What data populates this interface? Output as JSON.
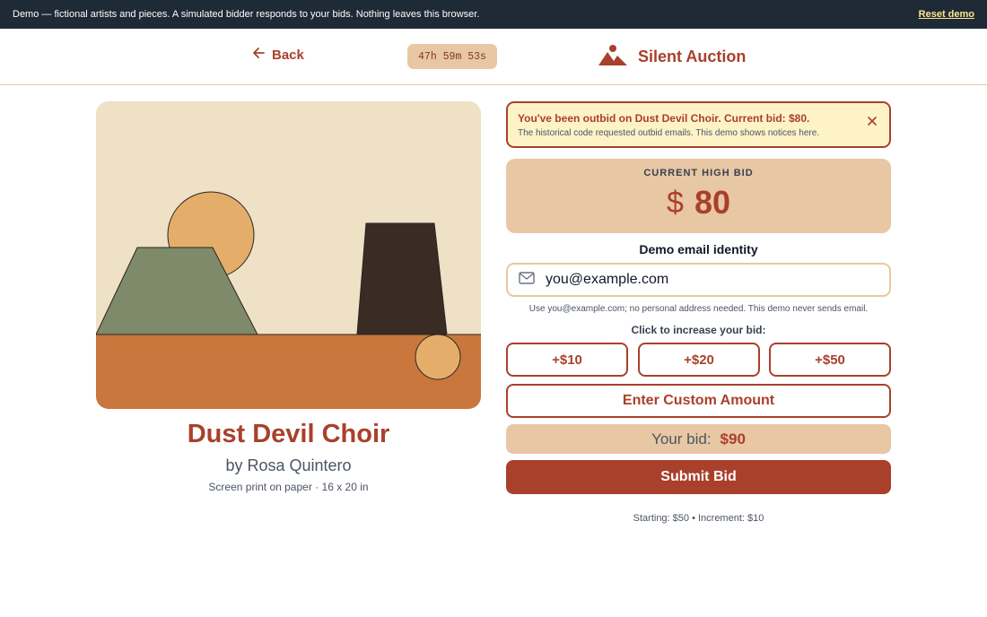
{
  "banner": {
    "message": "Demo — fictional artists and pieces. A simulated bidder responds to your bids. Nothing leaves this browser.",
    "reset_label": "Reset demo"
  },
  "header": {
    "back_label": "Back",
    "timer": "47h 59m 53s",
    "brand_title": "Silent Auction"
  },
  "artwork": {
    "title": "Dust Devil Choir",
    "artist": "by Rosa Quintero",
    "medium": "Screen print on paper",
    "separator": "·",
    "dimensions": "16 x 20 in"
  },
  "notice": {
    "headline": "You've been outbid on Dust Devil Choir. Current bid: $80.",
    "detail": "The historical code requested outbid emails. This demo shows notices here.",
    "close_icon": "close-icon"
  },
  "current_bid": {
    "label": "CURRENT HIGH BID",
    "currency": "$",
    "amount": "80"
  },
  "email": {
    "label": "Demo email identity",
    "value": "you@example.com",
    "help": "Use you@example.com; no personal address needed. This demo never sends email."
  },
  "increments": {
    "label": "Click to increase your bid:",
    "buttons": [
      "+$10",
      "+$20",
      "+$50"
    ],
    "custom_label": "Enter Custom Amount"
  },
  "your_bid": {
    "label": "Your bid:",
    "value": "$90"
  },
  "submit_label": "Submit Bid",
  "footer_note": "Starting: $50 • Increment: $10",
  "colors": {
    "accent": "#a9402b",
    "tan": "#e8c7a4",
    "banner_bg": "#1f2a37",
    "notice_bg": "#fef3c7"
  }
}
